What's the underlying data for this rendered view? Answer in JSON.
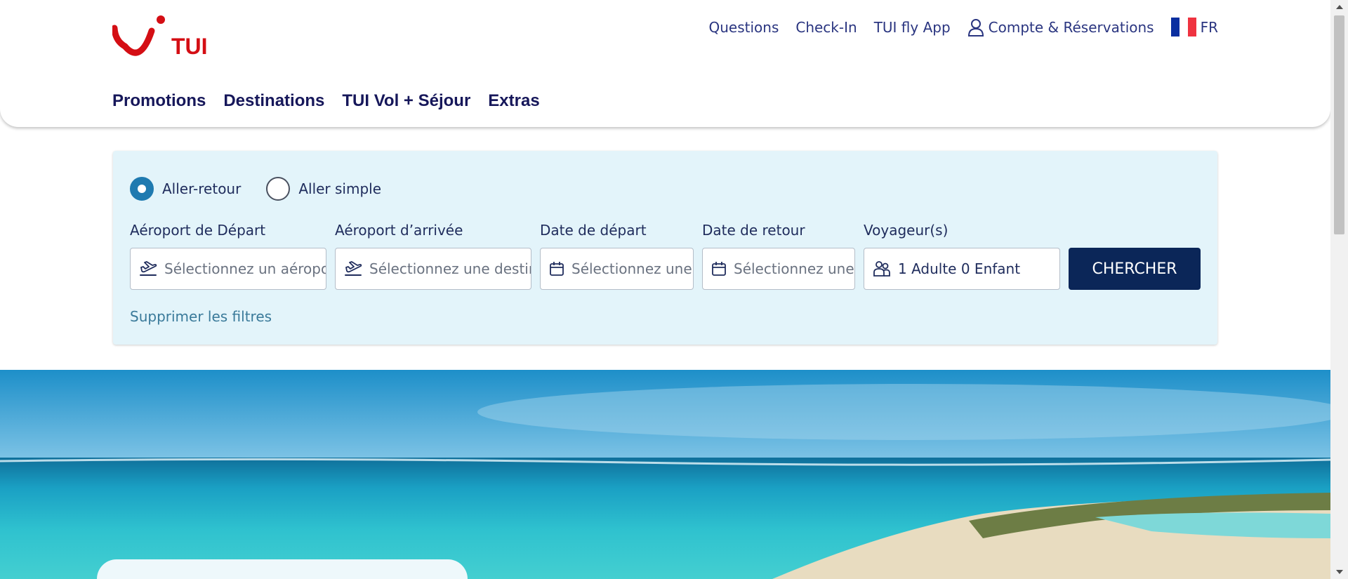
{
  "header": {
    "logo_text": "TUI",
    "top_links": {
      "questions": "Questions",
      "checkin": "Check-In",
      "app": "TUI fly App",
      "account": "Compte & Réservations",
      "lang": "FR"
    },
    "nav": [
      "Promotions",
      "Destinations",
      "TUI Vol + Séjour",
      "Extras"
    ]
  },
  "search": {
    "trip_types": [
      "Aller-retour",
      "Aller simple"
    ],
    "selected_trip": "Aller-retour",
    "fields": {
      "departure": {
        "label": "Aéroport de Départ",
        "placeholder": "Sélectionnez un aéroport",
        "icon": "plane-takeoff-icon"
      },
      "arrival": {
        "label": "Aéroport d’arrivée",
        "placeholder": "Sélectionnez une destination",
        "icon": "plane-takeoff-icon"
      },
      "depart_date": {
        "label": "Date de départ",
        "placeholder": "Sélectionnez une date",
        "icon": "calendar-icon"
      },
      "return_date": {
        "label": "Date de retour",
        "placeholder": "Sélectionnez une date",
        "icon": "calendar-icon"
      },
      "travellers": {
        "label": "Voyageur(s)",
        "value": "1 Adulte 0 Enfant",
        "icon": "people-icon"
      }
    },
    "search_button": "CHERCHER",
    "clear_filters": "Supprimer les filtres"
  },
  "colors": {
    "brand_red": "#d40e14",
    "nav_text": "#16175a",
    "panel_bg": "#e3f4fa",
    "button_bg": "#0b2658",
    "radio_checked": "#1f7ab0",
    "flag": [
      "#0a2fa0",
      "#ffffff",
      "#ef3340"
    ]
  }
}
